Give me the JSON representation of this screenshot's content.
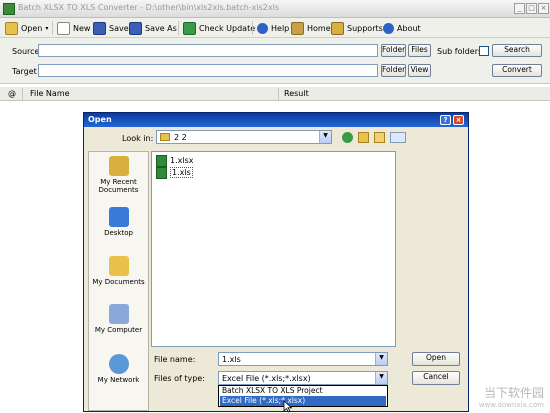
{
  "window": {
    "title": "Batch XLSX TO XLS Converter - D:\\other\\bin\\xls2xls.batch-xls2xls",
    "controls": [
      "_",
      "□",
      "×"
    ]
  },
  "toolbar": {
    "open": "Open",
    "new": "New",
    "save": "Save",
    "save_as": "Save As",
    "check_update": "Check Update",
    "help": "Help",
    "home": "Home",
    "supports": "Supports",
    "about": "About"
  },
  "form": {
    "source_label": "Source",
    "source_value": "",
    "folder_button": "Folder",
    "files_button": "Files",
    "sub_folders_label": "Sub folders",
    "search_button": "Search",
    "target_label": "Target",
    "target_value": "",
    "target_folder_button": "Folder",
    "view_button": "View",
    "convert_button": "Convert"
  },
  "grid": {
    "columns": [
      "@",
      "File Name",
      "Result"
    ]
  },
  "dialog": {
    "title": "Open",
    "look_in_label": "Look in:",
    "look_in_value": "2 2",
    "places": [
      "My Recent Documents",
      "Desktop",
      "My Documents",
      "My Computer",
      "My Network"
    ],
    "files": [
      "1.xlsx",
      "1.xls"
    ],
    "file_name_label": "File name:",
    "file_name_value": "1.xls",
    "files_of_type_label": "Files of type:",
    "files_of_type_value": "Excel File (*.xls;*.xlsx)",
    "type_options": [
      "Batch XLSX TO XLS Project",
      "Excel File (*.xls;*.xlsx)"
    ],
    "open_button": "Open",
    "cancel_button": "Cancel"
  },
  "watermark": {
    "text": "当下软件园",
    "url": "www.downxia.com"
  },
  "colors": {
    "dialog_title_bar": "#0a3ba0",
    "dialog_background": "#ece9d8",
    "selection": "#316ac5"
  }
}
